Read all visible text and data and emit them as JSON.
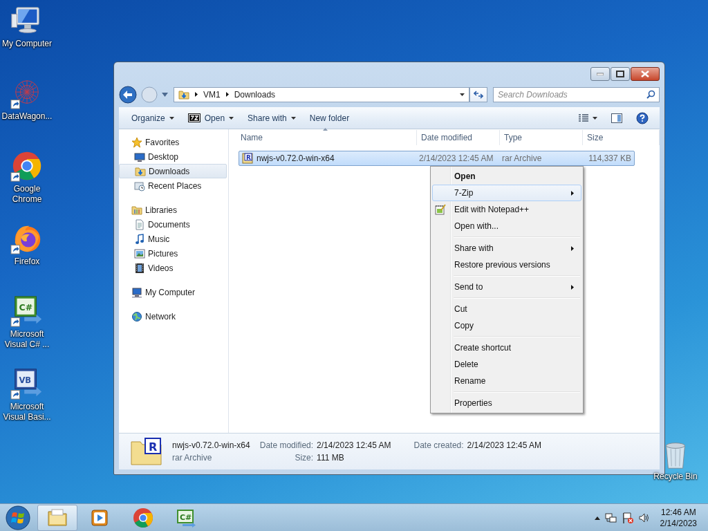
{
  "desktop_icons": [
    {
      "label": "My Computer",
      "kind": "computer",
      "shortcut": false
    },
    {
      "label": "DataWagon...",
      "kind": "mesh",
      "shortcut": true
    },
    {
      "label": "Google Chrome",
      "kind": "browser",
      "shortcut": true
    },
    {
      "label": "Firefox",
      "kind": "fox",
      "shortcut": true
    },
    {
      "label": "Microsoft Visual C# ...",
      "kind": "csharp",
      "shortcut": true,
      "icon_letters": "C#"
    },
    {
      "label": "Microsoft Visual Basi...",
      "kind": "vb",
      "shortcut": true,
      "icon_letters": "VB"
    }
  ],
  "recycle_bin": {
    "label": "Recycle Bin"
  },
  "window": {
    "breadcrumb": [
      "VM1",
      "Downloads"
    ],
    "search": {
      "placeholder": "Search Downloads"
    },
    "toolbar": [
      {
        "label": "Organize",
        "kind": "plain",
        "dropdown": true
      },
      {
        "label": "Open",
        "kind": "archiver",
        "dropdown": true
      },
      {
        "label": "Share with",
        "kind": "plain",
        "dropdown": true
      },
      {
        "label": "New folder",
        "kind": "plain",
        "dropdown": false
      }
    ],
    "sidebar": [
      {
        "label": "Favorites",
        "kind": "star",
        "selected": false,
        "children": [
          {
            "label": "Desktop",
            "kind": "desktop",
            "selected": false
          },
          {
            "label": "Downloads",
            "kind": "downloads",
            "selected": true
          },
          {
            "label": "Recent Places",
            "kind": "recent",
            "selected": false
          }
        ]
      },
      {
        "label": "Libraries",
        "kind": "libraries",
        "selected": false,
        "children": [
          {
            "label": "Documents",
            "kind": "documents",
            "selected": false
          },
          {
            "label": "Music",
            "kind": "music",
            "selected": false
          },
          {
            "label": "Pictures",
            "kind": "pictures",
            "selected": false
          },
          {
            "label": "Videos",
            "kind": "videos",
            "selected": false
          }
        ]
      },
      {
        "label": "My Computer",
        "kind": "computer",
        "selected": false
      },
      {
        "label": "Network",
        "kind": "network",
        "selected": false
      }
    ],
    "table": {
      "columns": [
        {
          "label": "Name",
          "sorted": true
        },
        {
          "label": "Date modified",
          "sorted": false
        },
        {
          "label": "Type",
          "sorted": false
        },
        {
          "label": "Size",
          "sorted": false
        }
      ],
      "rows": [
        {
          "name": "nwjs-v0.72.0-win-x64",
          "icon_letters": "R",
          "date_modified": "2/14/2023 12:45 AM",
          "type": "rar Archive",
          "size": "114,337 KB",
          "selected": true
        }
      ]
    },
    "details": {
      "icon_letters": "R",
      "name": "nwjs-v0.72.0-win-x64",
      "type": "rar Archive",
      "fields": [
        {
          "label": "Date modified:",
          "value": "2/14/2023 12:45 AM"
        },
        {
          "label": "Date created:",
          "value": "2/14/2023 12:45 AM"
        },
        {
          "label": "Size:",
          "value": "111 MB"
        }
      ]
    }
  },
  "context_menu": [
    {
      "kind": "item",
      "label": "Open",
      "bold": true,
      "submenu": false,
      "selected": false
    },
    {
      "kind": "item",
      "label": "7-Zip",
      "bold": false,
      "submenu": true,
      "selected": true
    },
    {
      "kind": "notepad_item",
      "label": "Edit with Notepad++",
      "bold": false,
      "submenu": false,
      "selected": false
    },
    {
      "kind": "item",
      "label": "Open with...",
      "bold": false,
      "submenu": false,
      "selected": false
    },
    {
      "kind": "separator"
    },
    {
      "kind": "item",
      "label": "Share with",
      "bold": false,
      "submenu": true,
      "selected": false
    },
    {
      "kind": "item",
      "label": "Restore previous versions",
      "bold": false,
      "submenu": false,
      "selected": false
    },
    {
      "kind": "separator"
    },
    {
      "kind": "item",
      "label": "Send to",
      "bold": false,
      "submenu": true,
      "selected": false
    },
    {
      "kind": "separator"
    },
    {
      "kind": "item",
      "label": "Cut",
      "bold": false,
      "submenu": false,
      "selected": false
    },
    {
      "kind": "item",
      "label": "Copy",
      "bold": false,
      "submenu": false,
      "selected": false
    },
    {
      "kind": "separator"
    },
    {
      "kind": "item",
      "label": "Create shortcut",
      "bold": false,
      "submenu": false,
      "selected": false
    },
    {
      "kind": "item",
      "label": "Delete",
      "bold": false,
      "submenu": false,
      "selected": false
    },
    {
      "kind": "item",
      "label": "Rename",
      "bold": false,
      "submenu": false,
      "selected": false
    },
    {
      "kind": "separator"
    },
    {
      "kind": "item",
      "label": "Properties",
      "bold": false,
      "submenu": false,
      "selected": false
    }
  ],
  "taskbar": {
    "items": [
      {
        "kind": "explorer",
        "selected": true
      },
      {
        "kind": "media",
        "selected": false
      },
      {
        "kind": "browser",
        "selected": false
      },
      {
        "kind": "csharp",
        "selected": false,
        "icon_letters": "C#"
      }
    ],
    "time": "12:46 AM",
    "date": "2/14/2023"
  }
}
